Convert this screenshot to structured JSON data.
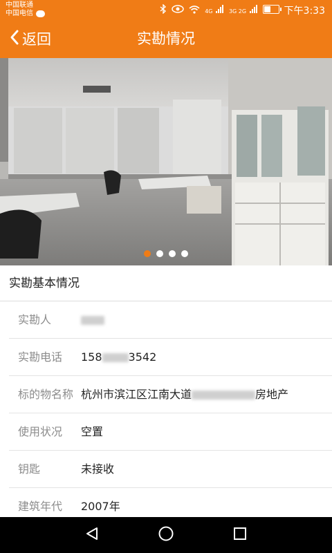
{
  "status": {
    "carrier1": "中国联通",
    "carrier2": "中国电信",
    "network": "4G",
    "network2": "3G 2G",
    "battery_level": 0.45,
    "time": "下午3:33"
  },
  "header": {
    "back_label": "返回",
    "title": "实勘情况"
  },
  "carousel": {
    "slide_count": 4,
    "active_index": 0
  },
  "section": {
    "title": "实勘基本情况"
  },
  "details": [
    {
      "label": "实勘人",
      "value": ""
    },
    {
      "label": "实勘电话",
      "value_prefix": "158",
      "value_suffix": "3542"
    },
    {
      "label": "标的物名称",
      "value_prefix": "杭州市滨江区江南大道",
      "value_suffix": "房地产"
    },
    {
      "label": "使用状况",
      "value": "空置"
    },
    {
      "label": "钥匙",
      "value": "未接收"
    },
    {
      "label": "建筑年代",
      "value": "2007年"
    }
  ],
  "colors": {
    "accent": "#f07c16",
    "label_gray": "#8c8c8c",
    "text": "#222222"
  },
  "icons": [
    "back-chevron-icon",
    "bluetooth-icon",
    "eye-icon",
    "wifi-icon",
    "signal-icon",
    "battery-icon",
    "nav-back-icon",
    "nav-home-icon",
    "nav-recents-icon"
  ]
}
